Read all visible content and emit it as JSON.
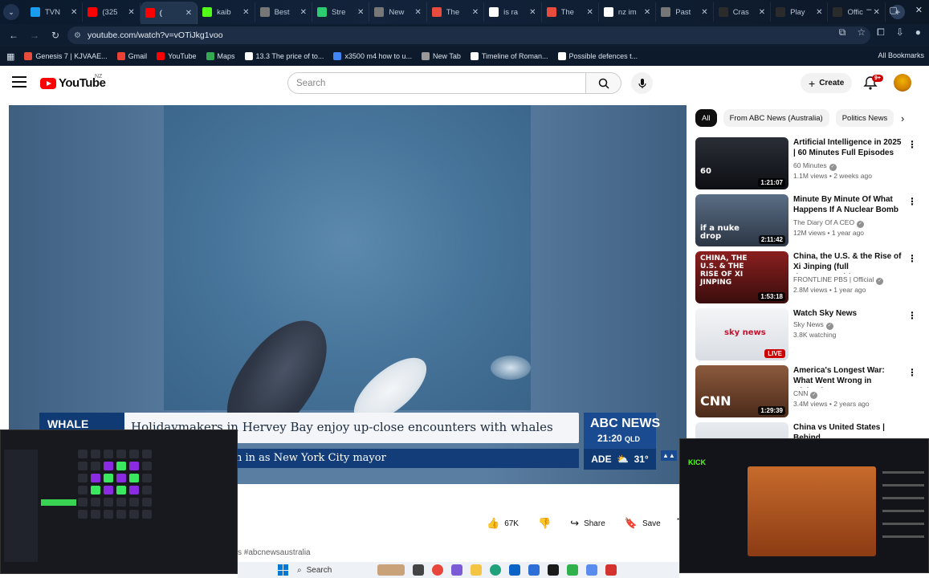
{
  "browser": {
    "tabs": [
      {
        "label": "TVN",
        "color": "#1a9cf0",
        "active": false
      },
      {
        "label": "(325",
        "color": "#ff0000",
        "active": false
      },
      {
        "label": "(",
        "color": "#ff0000",
        "active": true
      },
      {
        "label": "kaib",
        "color": "#53fc18",
        "active": false
      },
      {
        "label": "Best",
        "color": "#777777",
        "active": false
      },
      {
        "label": "Stre",
        "color": "#2ecc71",
        "active": false
      },
      {
        "label": "New",
        "color": "#777777",
        "active": false
      },
      {
        "label": "The",
        "color": "#e74c3c",
        "active": false
      },
      {
        "label": "is ra",
        "color": "#ffffff",
        "active": false
      },
      {
        "label": "The",
        "color": "#e74c3c",
        "active": false
      },
      {
        "label": "nz im",
        "color": "#ffffff",
        "active": false
      },
      {
        "label": "Past",
        "color": "#777777",
        "active": false
      },
      {
        "label": "Cras",
        "color": "#2b2b2b",
        "active": false
      },
      {
        "label": "Play",
        "color": "#2b2b2b",
        "active": false
      },
      {
        "label": "Offic",
        "color": "#2b2b2b",
        "active": false
      }
    ],
    "url": "youtube.com/watch?v=vOTiJkg1voo",
    "bookmarks": [
      {
        "label": "Genesis 7 | KJVAAE...",
        "color": "#e74c3c"
      },
      {
        "label": "Gmail",
        "color": "#ea4335"
      },
      {
        "label": "YouTube",
        "color": "#ff0000"
      },
      {
        "label": "Maps",
        "color": "#34a853"
      },
      {
        "label": "13.3 The price of to...",
        "color": "#ffffff"
      },
      {
        "label": "x3500 m4 how to u...",
        "color": "#4285f4"
      },
      {
        "label": "New Tab",
        "color": "#999999"
      },
      {
        "label": "Timeline of Roman...",
        "color": "#ffffff"
      },
      {
        "label": "Possible defences t...",
        "color": "#ffffff"
      }
    ],
    "all_bookmarks_label": "All Bookmarks"
  },
  "youtube": {
    "logo_text": "YouTube",
    "region": "NZ",
    "search_placeholder": "Search",
    "create_label": "Create",
    "notification_count": "9+"
  },
  "video": {
    "lower_third_tag": "WHALE",
    "headline": "Holidaymakers in Hervey Bay enjoy up-close encounters with whales",
    "ticker": "n in as New York City mayor",
    "abc_news_label": "ABC NEWS",
    "time": "21:20",
    "time_zone": "QLD",
    "weather_city": "ADE",
    "weather_temp": "31°"
  },
  "actions": {
    "like_count": "67K",
    "share_label": "Share",
    "save_label": "Save",
    "hashtags": "s #abcnewsaustralia"
  },
  "sidebar": {
    "chips": [
      {
        "label": "All",
        "active": true
      },
      {
        "label": "From ABC News (Australia)",
        "active": false
      },
      {
        "label": "Politics News",
        "active": false
      }
    ],
    "recommendations": [
      {
        "title": "Artificial Intelligence in 2025 | 60 Minutes Full Episodes",
        "channel": "60 Minutes",
        "meta": "1.1M views • 2 weeks ago",
        "duration": "1:21:07",
        "thumb_top": "#2a2e36",
        "thumb_bottom": "#0d0f14",
        "overlay": "60"
      },
      {
        "title": "Minute By Minute Of What Happens If A Nuclear Bomb ...",
        "channel": "The Diary Of A CEO",
        "meta": "12M views • 1 year ago",
        "duration": "2:11:42",
        "thumb_top": "#5a6e86",
        "thumb_bottom": "#2c3644",
        "overlay": "if a nuke drop"
      },
      {
        "title": "China, the U.S. & the Rise of Xi Jinping (full documentary) | ...",
        "channel": "FRONTLINE PBS | Official",
        "meta": "2.8M views • 1 year ago",
        "duration": "1:53:18",
        "thumb_top": "#8a1f1f",
        "thumb_bottom": "#3a0d0d",
        "overlay": "CHINA, THE U.S. & THE RISE OF XI JINPING"
      },
      {
        "title": "Watch Sky News",
        "channel": "Sky News",
        "meta": "3.8K watching",
        "duration": "",
        "live": "LIVE",
        "thumb_top": "#f4f5f7",
        "thumb_bottom": "#d9dde3",
        "overlay": "sky news"
      },
      {
        "title": "America's Longest War: What Went Wrong in Afghanistan ...",
        "channel": "CNN",
        "meta": "3.4M views • 2 years ago",
        "duration": "1:29:39",
        "thumb_top": "#8c5a3c",
        "thumb_bottom": "#4a2a1a",
        "overlay": "CNN"
      },
      {
        "title": "China vs United States | Behind",
        "channel": "",
        "meta": "",
        "duration": "",
        "thumb_top": "#e8ecf0",
        "thumb_bottom": "#c9d1da",
        "overlay": ""
      }
    ]
  },
  "taskbar": {
    "search_label": "Search"
  }
}
